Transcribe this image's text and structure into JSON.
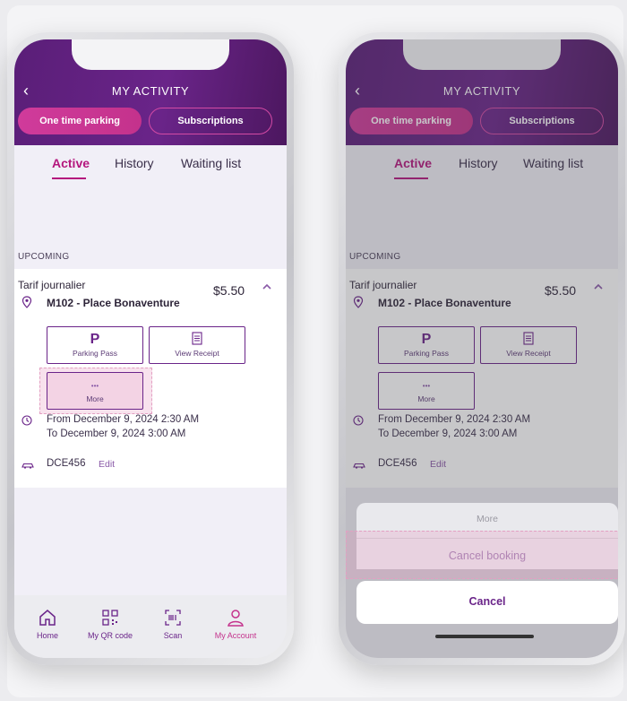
{
  "colors": {
    "brand_purple": "#6a2489",
    "accent_pink": "#c4328c",
    "active_tab": "#b4167d"
  },
  "header": {
    "back_icon": "chevron-left-icon",
    "back_glyph": "‹",
    "title": "MY ACTIVITY"
  },
  "segments": {
    "active": "One time parking",
    "other": "Subscriptions"
  },
  "tabs": [
    "Active",
    "History",
    "Waiting list"
  ],
  "section_label": "UPCOMING",
  "booking": {
    "plan": "Tarif journalier",
    "price": "$5.50",
    "location": "M102 - Place Bonaventure",
    "actions": [
      {
        "label": "Parking Pass",
        "icon": "parking-p-icon",
        "glyph": "P"
      },
      {
        "label": "View Receipt",
        "icon": "receipt-icon"
      },
      {
        "label": "More",
        "icon": "more-dots-icon",
        "glyph": "•••"
      }
    ],
    "from": "From December 9, 2024 2:30 AM",
    "to": "To December 9, 2024 3:00 AM",
    "plate": "DCE456",
    "edit": "Edit"
  },
  "bottom_nav": [
    {
      "label": "Home",
      "icon": "home-icon"
    },
    {
      "label": "My QR code",
      "icon": "qr-code-icon"
    },
    {
      "label": "Scan",
      "icon": "barcode-scan-icon"
    },
    {
      "label": "My Account",
      "icon": "user-icon"
    }
  ],
  "action_sheet": {
    "title": "More",
    "option": "Cancel booking",
    "cancel": "Cancel"
  }
}
